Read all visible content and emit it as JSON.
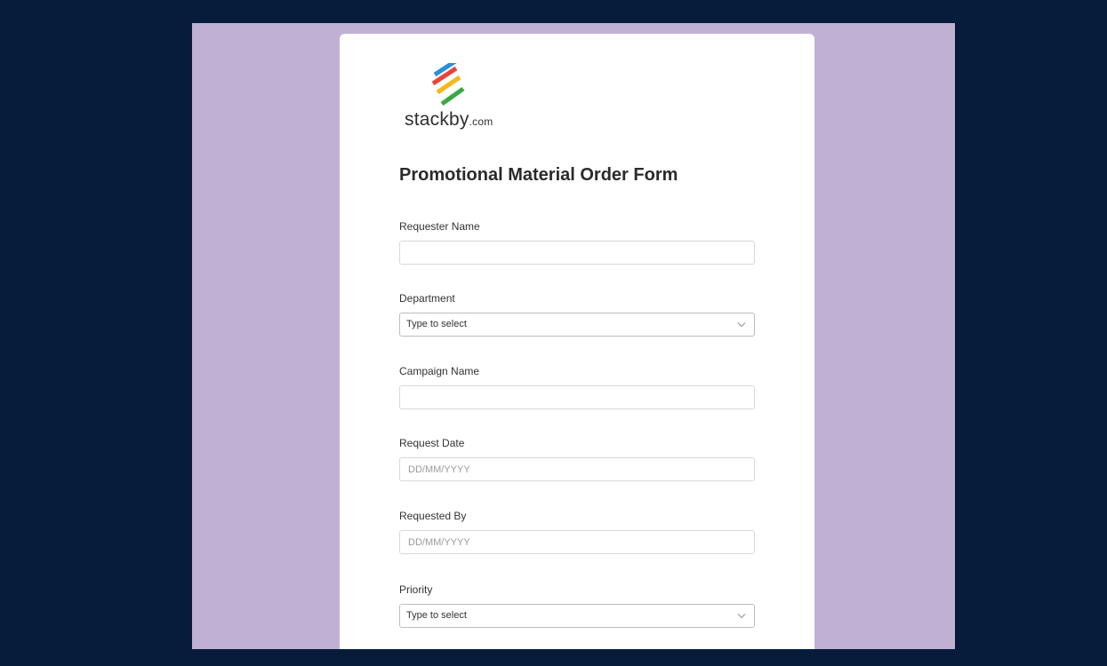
{
  "brand": {
    "name": "stackby",
    "domain": ".com",
    "logo_colors": [
      "#2a8fd8",
      "#e8443a",
      "#f6b719",
      "#3aa843"
    ]
  },
  "colors": {
    "page_background": "#071b3b",
    "panel_background": "#c0b1d4",
    "card_background": "#ffffff"
  },
  "form": {
    "title": "Promotional Material Order Form",
    "fields": [
      {
        "label": "Requester Name",
        "type": "text",
        "value": "",
        "placeholder": ""
      },
      {
        "label": "Department",
        "type": "select",
        "value": "Type to select",
        "icon": "chevron-down-icon"
      },
      {
        "label": "Campaign Name",
        "type": "text",
        "value": "",
        "placeholder": ""
      },
      {
        "label": "Request Date",
        "type": "date",
        "value": "",
        "placeholder": "DD/MM/YYYY"
      },
      {
        "label": "Requested By",
        "type": "date",
        "value": "",
        "placeholder": "DD/MM/YYYY"
      },
      {
        "label": "Priority",
        "type": "select",
        "value": "Type to select",
        "icon": "chevron-down-icon"
      }
    ]
  }
}
